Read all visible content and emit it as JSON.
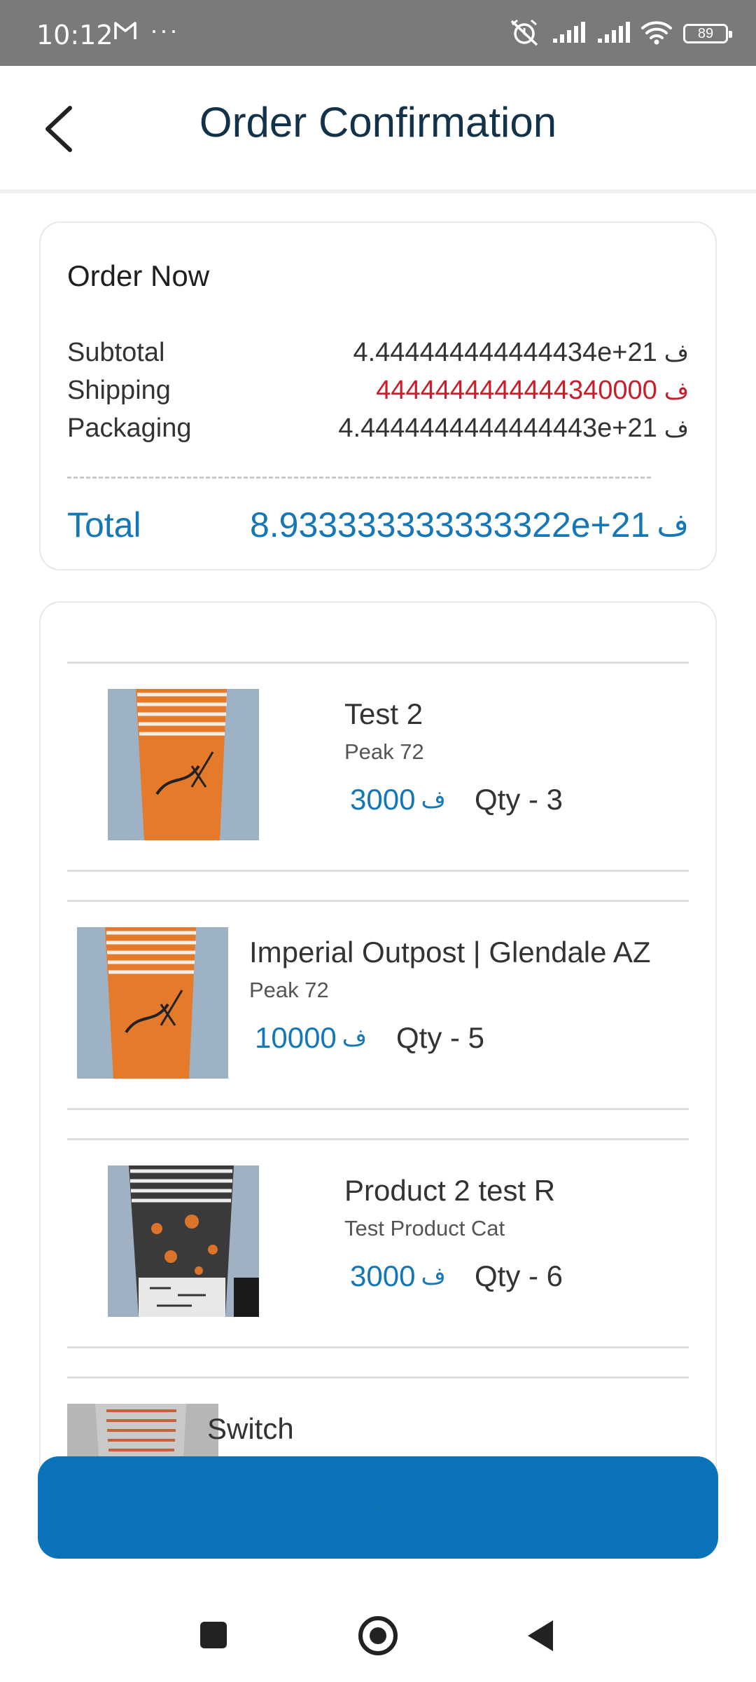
{
  "status_bar": {
    "time": "10:12",
    "dots": "···",
    "battery": "89"
  },
  "header": {
    "title": "Order Confirmation"
  },
  "summary": {
    "heading": "Order Now",
    "currency": "ف",
    "subtotal_label": "Subtotal",
    "subtotal_value": "4.444444444444434e+21",
    "shipping_label": "Shipping",
    "shipping_value": "4444444444444340000",
    "packaging_label": "Packaging",
    "packaging_value": "4.4444444444444443e+21",
    "total_label": "Total",
    "total_value": "8.933333333333322e+21"
  },
  "items": [
    {
      "name": "Test 2",
      "category": "Peak 72",
      "price": "3000",
      "qty": "Qty - 3"
    },
    {
      "name": "Imperial Outpost | Glendale AZ",
      "category": "Peak 72",
      "price": "10000",
      "qty": "Qty - 5"
    },
    {
      "name": "Product 2 test R",
      "category": "Test Product Cat",
      "price": "3000",
      "qty": "Qty - 6"
    },
    {
      "name": "Switch",
      "category": "",
      "price": "",
      "qty": ""
    }
  ],
  "colors": {
    "accent": "#1577b5",
    "button": "#0a73ba",
    "shipping": "#c81e2b",
    "status_bar": "#7a7a7a"
  }
}
